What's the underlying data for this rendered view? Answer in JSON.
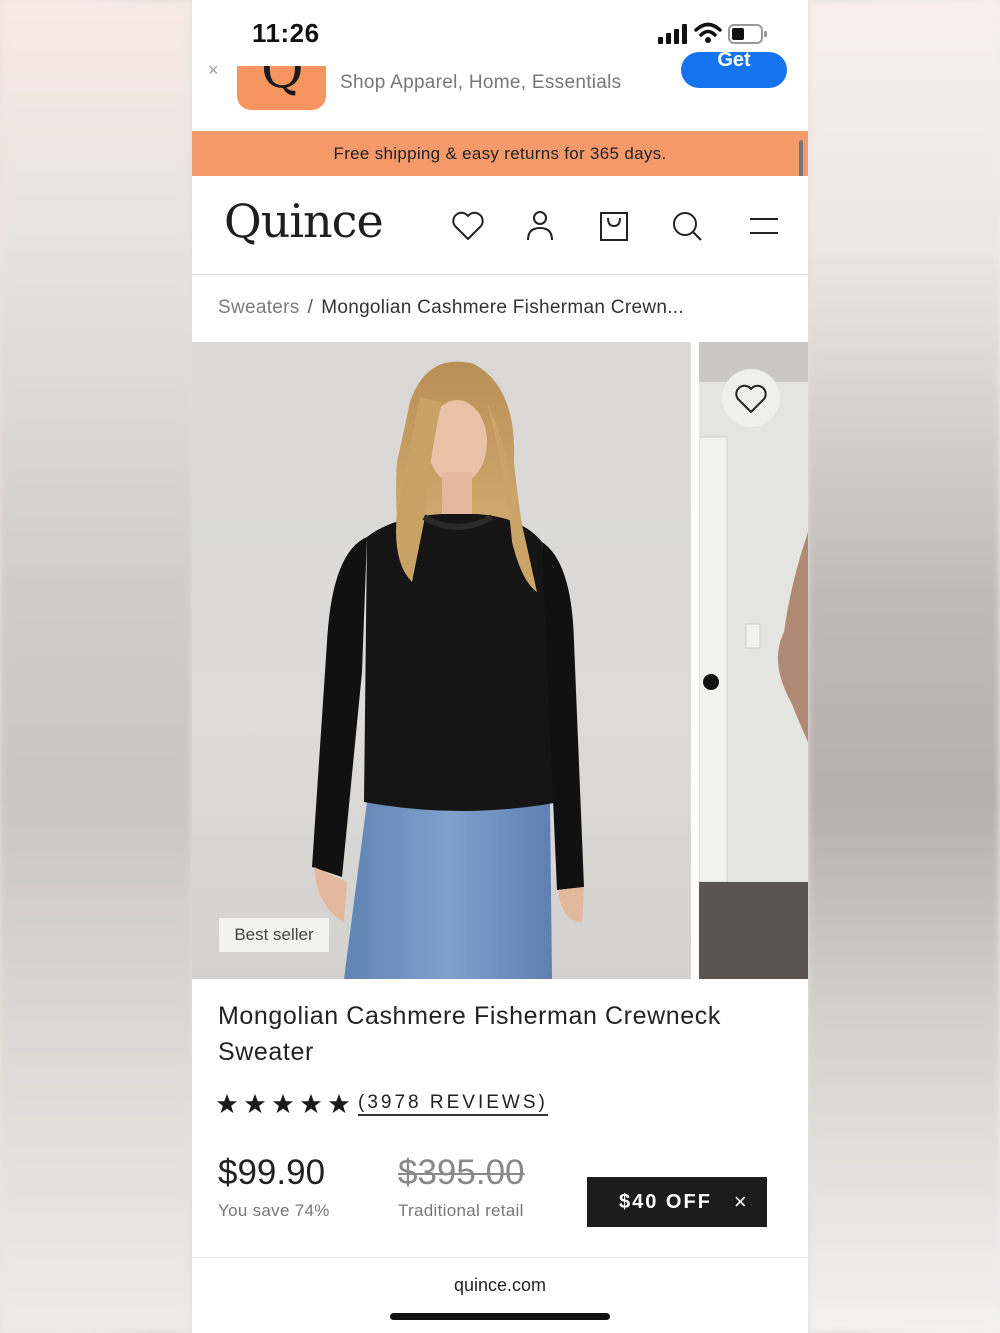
{
  "status_bar": {
    "time": "11:26"
  },
  "app_banner": {
    "app_letter": "Q",
    "description": "Shop Apparel, Home, Essentials",
    "get_label": "Get"
  },
  "promo_banner": {
    "text": "Free shipping & easy returns for 365 days."
  },
  "header": {
    "logo": "Quince"
  },
  "breadcrumb": {
    "category": "Sweaters",
    "separator": "/",
    "current": "Mongolian Cashmere Fisherman Crewn..."
  },
  "gallery": {
    "badge": "Best seller"
  },
  "product": {
    "title": "Mongolian Cashmere Fisherman Crewneck Sweater",
    "rating": 5,
    "reviews_label": "(3978 REVIEWS)",
    "price": "$99.90",
    "you_save": "You save 74%",
    "traditional_price": "$395.00",
    "traditional_label": "Traditional retail"
  },
  "discount": {
    "label": "$40 OFF",
    "close": "×"
  },
  "browser": {
    "url": "quince.com"
  },
  "colors": {
    "promo": "#f79a6b",
    "app_icon": "#f79560",
    "get_button": "#1673f0",
    "discount_bg": "#1c1c1c"
  }
}
